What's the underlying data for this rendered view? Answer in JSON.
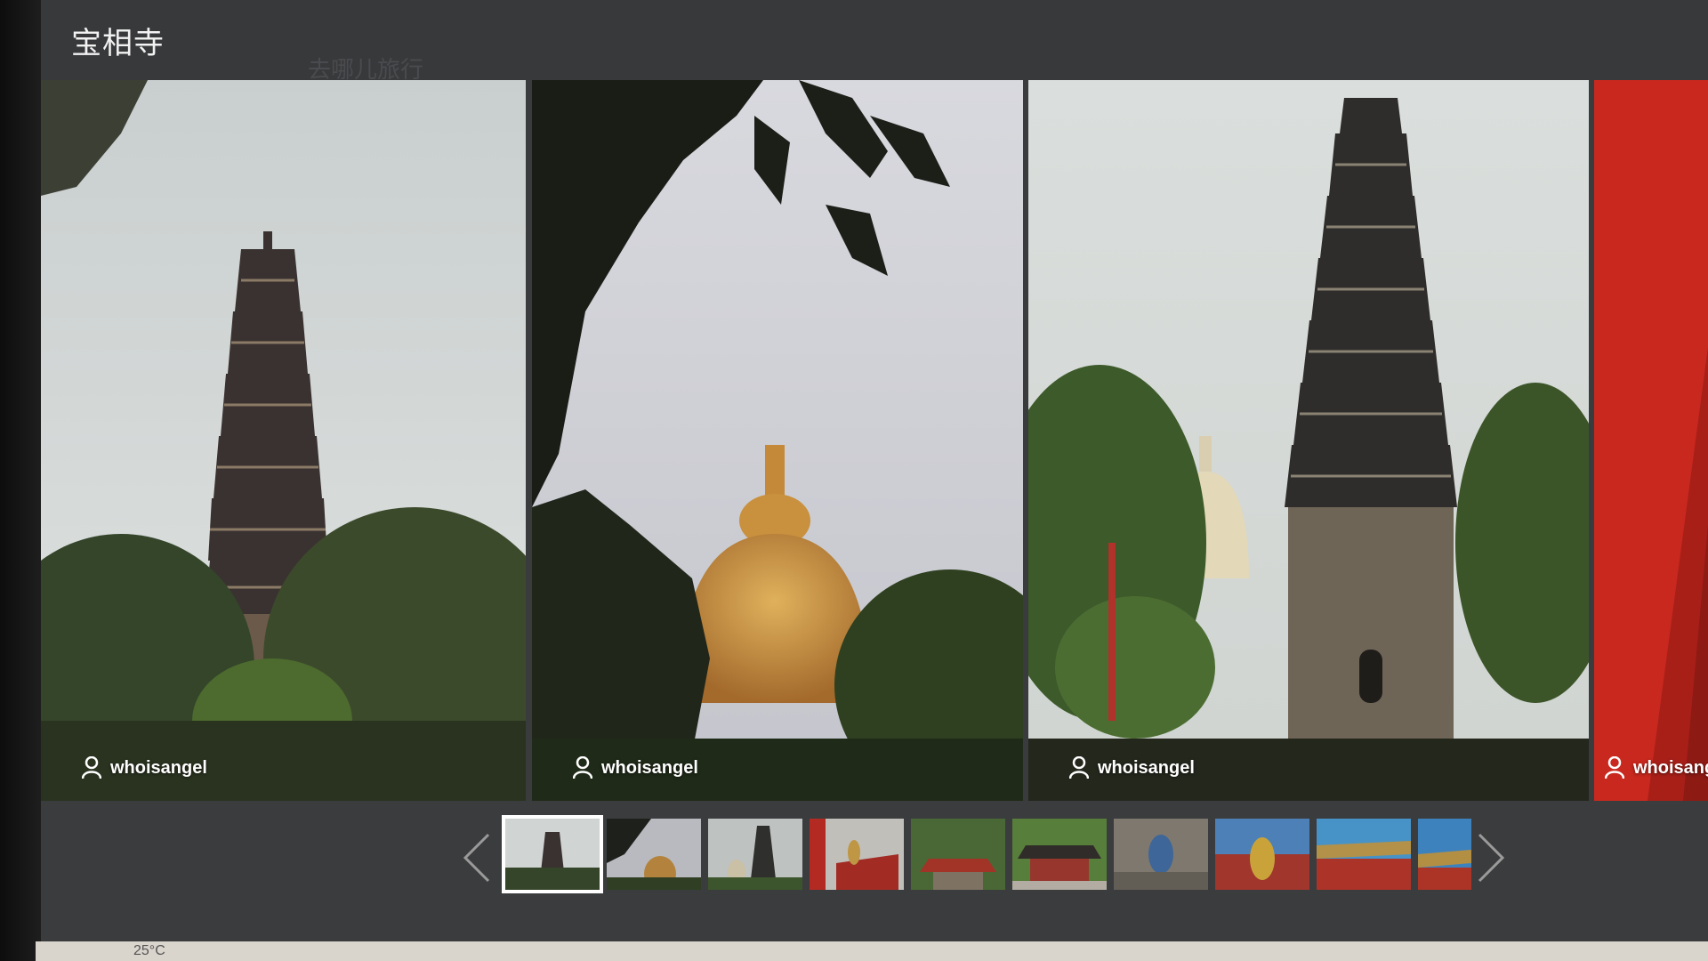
{
  "window": {
    "title": "宝相寺",
    "background_hint": "去哪儿旅行"
  },
  "photos": [
    {
      "credit": "whoisangel",
      "subject": "pagoda"
    },
    {
      "credit": "whoisangel",
      "subject": "golden-stupa"
    },
    {
      "credit": "whoisangel",
      "subject": "pagoda-and-stupa"
    },
    {
      "credit": "whoisangel",
      "subject": "red-wall"
    }
  ],
  "gallery": {
    "prev_label": "",
    "next_label": "",
    "thumbnail_count": 10,
    "active_index": 0
  },
  "taskbar": {
    "weather": "25°C"
  },
  "colors": {
    "titlebar": "#38393b",
    "red_accent": "#c8281e",
    "sky": "#d6dadb"
  }
}
